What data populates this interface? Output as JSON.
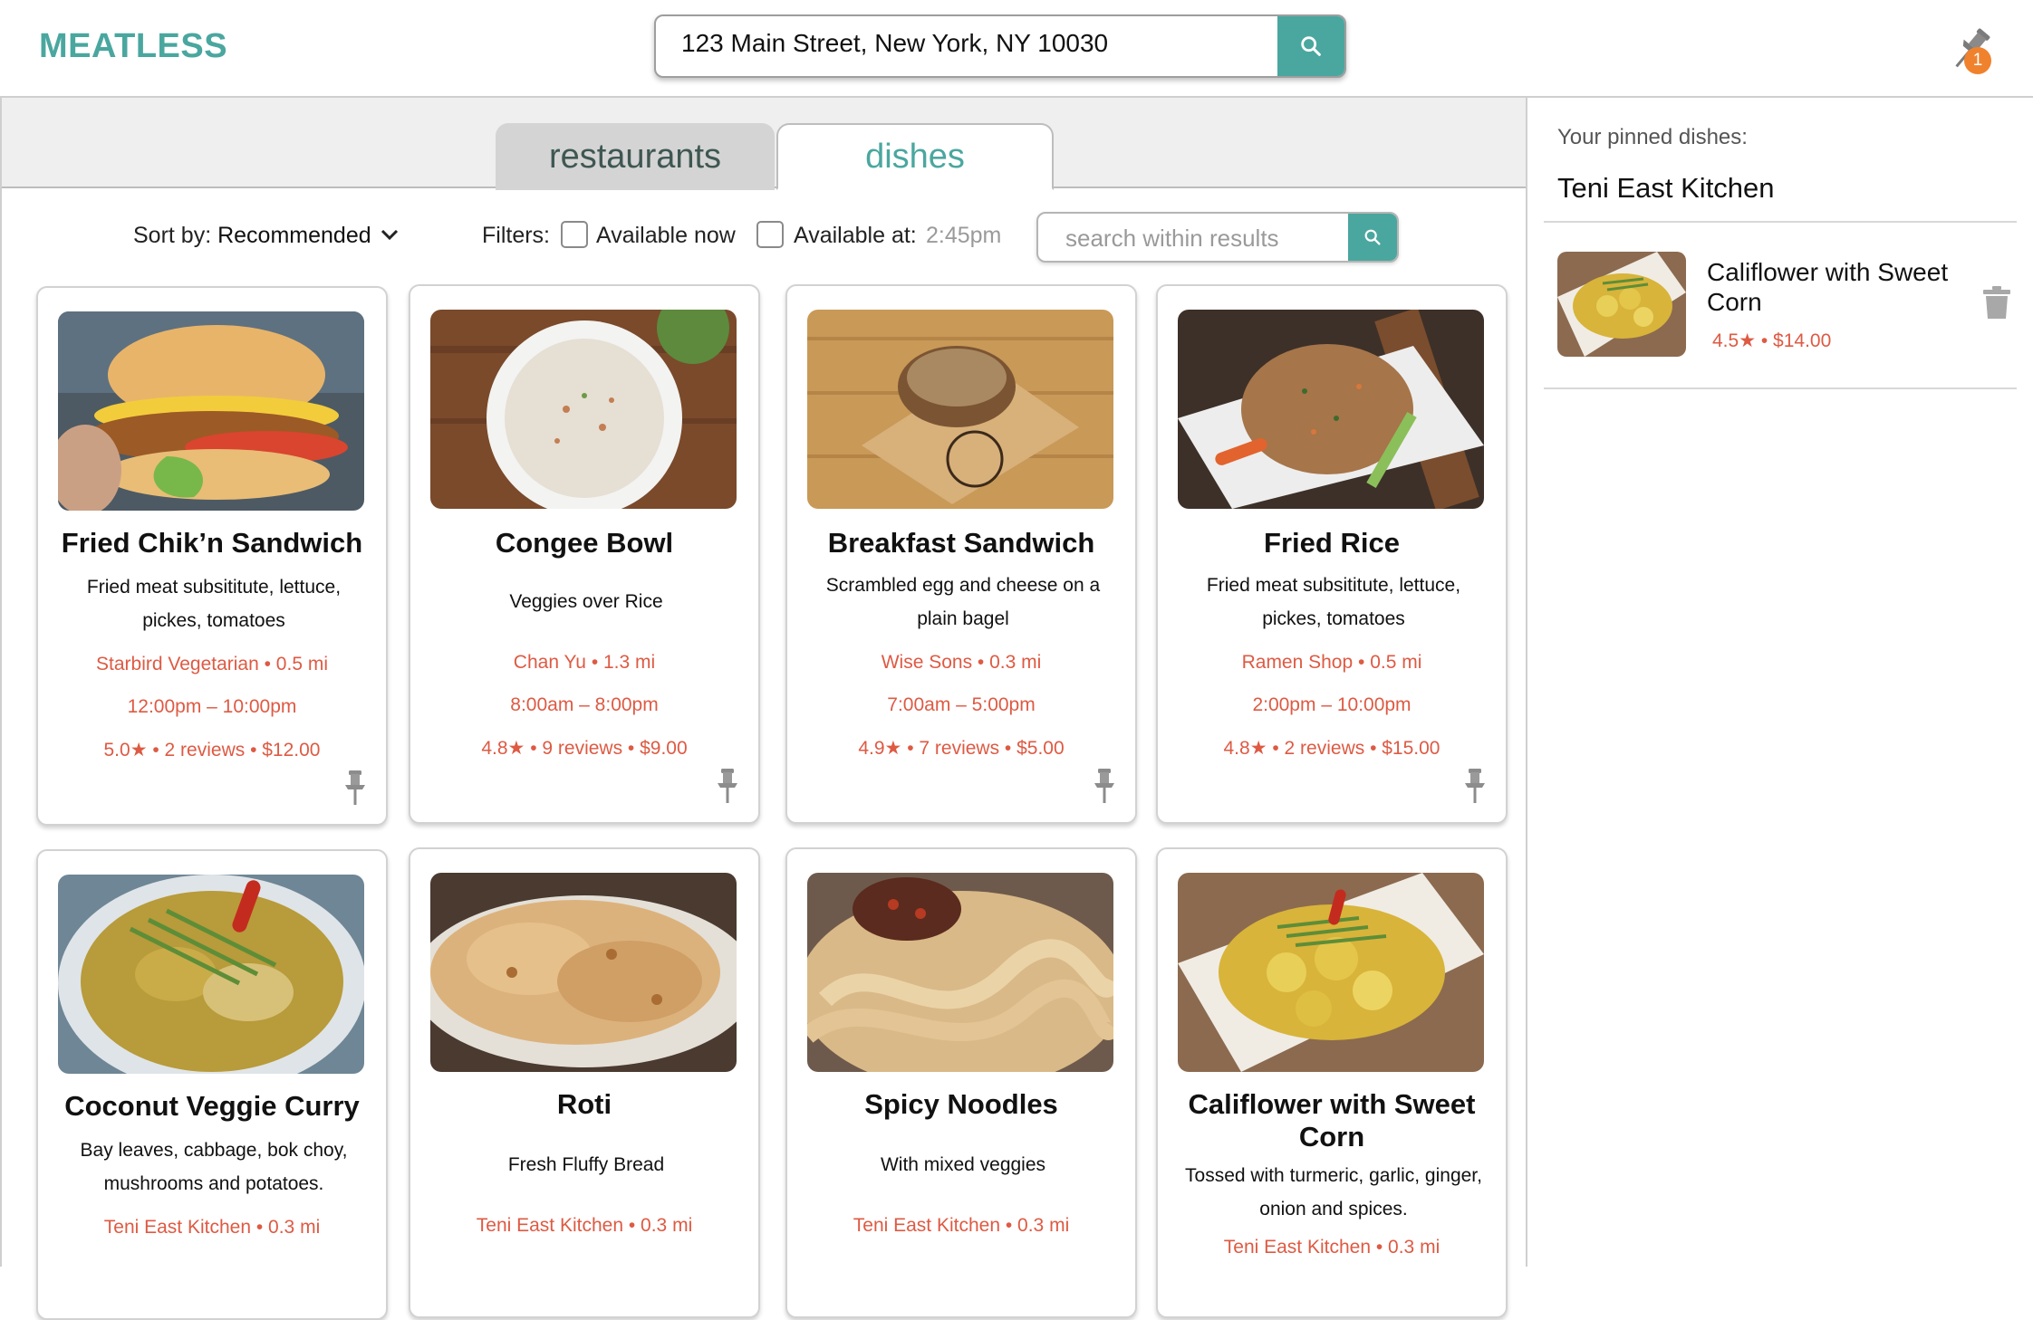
{
  "app": {
    "logo": "MEATLESS"
  },
  "header": {
    "address": "123 Main Street, New York, NY 10030",
    "pin_count": "1"
  },
  "tabs": [
    {
      "label": "restaurants",
      "active": false
    },
    {
      "label": "dishes",
      "active": true
    }
  ],
  "toolbar": {
    "sort_prefix": "Sort by: ",
    "sort_value": "Recommended",
    "filters_label": "Filters:",
    "available_now": "Available now",
    "available_at": "Available at:",
    "available_at_time": "2:45pm",
    "search_placeholder": "search within results"
  },
  "dishes": [
    {
      "title": "Fried Chik’n Sandwich",
      "desc": "Fried meat subsititute, lettuce, pickes, tomatoes",
      "place": "Starbird Vegetarian  •  0.5 mi",
      "hours": "12:00pm – 10:00pm",
      "meta": "5.0★ • 2 reviews • $12.00"
    },
    {
      "title": "Congee Bowl",
      "desc": "Veggies over Rice",
      "place": "Chan Yu •  1.3 mi",
      "hours": "8:00am – 8:00pm",
      "meta": "4.8★  • 9 reviews • $9.00"
    },
    {
      "title": "Breakfast Sandwich",
      "desc": "Scrambled egg and cheese on a plain bagel",
      "place": "Wise Sons  •  0.3 mi",
      "hours": "7:00am – 5:00pm",
      "meta": "4.9★ • 7 reviews • $5.00"
    },
    {
      "title": "Fried Rice",
      "desc": "Fried meat subsititute, lettuce, pickes, tomatoes",
      "place": "Ramen Shop  •  0.5 mi",
      "hours": "2:00pm – 10:00pm",
      "meta": "4.8★ • 2 reviews • $15.00"
    },
    {
      "title": "Coconut Veggie Curry",
      "desc": "Bay leaves, cabbage, bok choy, mushrooms and potatoes.",
      "place": "Teni East Kitchen  •  0.3 mi"
    },
    {
      "title": "Roti",
      "desc": "Fresh Fluffy Bread",
      "place": "Teni East Kitchen  •  0.3 mi"
    },
    {
      "title": "Spicy Noodles",
      "desc": "With mixed veggies",
      "place": "Teni East Kitchen  •  0.3 mi"
    },
    {
      "title": "Califlower with Sweet Corn",
      "desc": "Tossed with turmeric, garlic, ginger, onion and spices.",
      "place": "Teni East Kitchen  •  0.3 mi"
    }
  ],
  "sidebar": {
    "label": "Your pinned dishes:",
    "restaurant": "Teni East Kitchen",
    "item_title": "Califlower with Sweet Corn",
    "item_meta": "4.5★ • $14.00"
  },
  "colors": {
    "accent": "#4aa79f",
    "red": "#de5a43",
    "badge": "#f0822d"
  }
}
